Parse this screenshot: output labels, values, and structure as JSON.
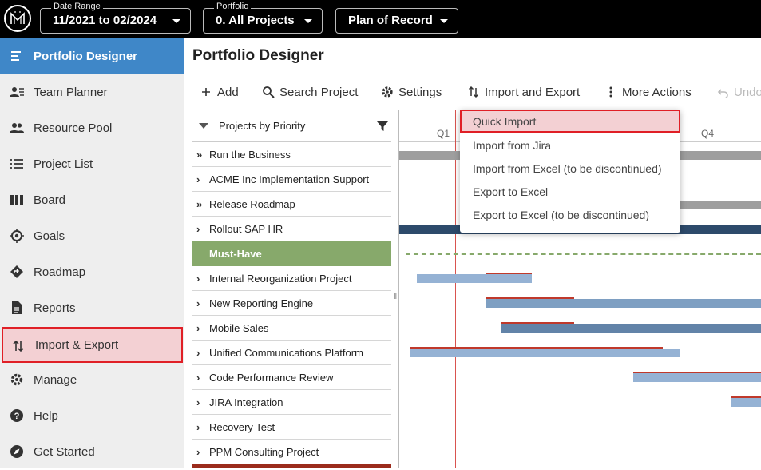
{
  "topbar": {
    "date_range": {
      "label": "Date Range",
      "value": "11/2021 to 02/2024"
    },
    "portfolio": {
      "label": "Portfolio",
      "value": "0. All Projects"
    },
    "plan": {
      "value": "Plan of Record"
    }
  },
  "sidebar": {
    "items": [
      {
        "label": "Portfolio Designer",
        "icon": "portfolio-icon"
      },
      {
        "label": "Team Planner",
        "icon": "team-icon"
      },
      {
        "label": "Resource Pool",
        "icon": "people-icon"
      },
      {
        "label": "Project List",
        "icon": "list-icon"
      },
      {
        "label": "Board",
        "icon": "board-icon"
      },
      {
        "label": "Goals",
        "icon": "target-icon"
      },
      {
        "label": "Roadmap",
        "icon": "roadmap-icon"
      },
      {
        "label": "Reports",
        "icon": "report-icon"
      },
      {
        "label": "Import & Export",
        "icon": "import-export-icon"
      },
      {
        "label": "Manage",
        "icon": "gear-icon"
      },
      {
        "label": "Help",
        "icon": "help-icon"
      },
      {
        "label": "Get Started",
        "icon": "compass-icon"
      }
    ]
  },
  "main": {
    "title": "Portfolio Designer",
    "toolbar": {
      "add": "Add",
      "search": "Search Project",
      "settings": "Settings",
      "import_export": "Import and Export",
      "more": "More Actions",
      "undo": "Undo"
    },
    "list_header": "Projects by Priority",
    "projects": [
      {
        "name": "Run the Business",
        "chev": "»"
      },
      {
        "name": "ACME Inc Implementation Support",
        "chev": "›"
      },
      {
        "name": "Release Roadmap",
        "chev": "»"
      },
      {
        "name": "Rollout SAP HR",
        "chev": "›"
      },
      {
        "name": "Must-Have",
        "chev": ""
      },
      {
        "name": "Internal Reorganization Project",
        "chev": "›"
      },
      {
        "name": "New Reporting Engine",
        "chev": "›"
      },
      {
        "name": "Mobile Sales",
        "chev": "›"
      },
      {
        "name": "Unified Communications Platform",
        "chev": "›"
      },
      {
        "name": "Code Performance Review",
        "chev": "›"
      },
      {
        "name": "JIRA Integration",
        "chev": "›"
      },
      {
        "name": "Recovery Test",
        "chev": "›"
      },
      {
        "name": "PPM Consulting Project",
        "chev": "›"
      }
    ],
    "gantt": {
      "q1": "Q1",
      "q4": "Q4"
    }
  },
  "menu": {
    "items": [
      "Quick Import",
      "Import from Jira",
      "Import from Excel (to be discontinued)",
      "Export to Excel",
      "Export to Excel (to be discontinued)"
    ]
  },
  "colors": {
    "accent": "#3f87c8",
    "highlight": "#e01f26",
    "group": "#87a96b"
  }
}
